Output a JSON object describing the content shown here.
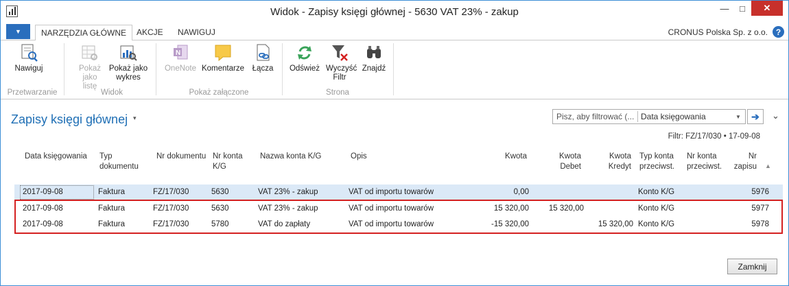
{
  "window": {
    "title": "Widok - Zapisy księgi głównej - 5630 VAT 23% - zakup",
    "controls": {
      "minimize": "—",
      "maximize": "□",
      "close": "✕"
    }
  },
  "ribbon_tabs": {
    "menu_arrow": "▼",
    "tabs": [
      {
        "label": "NARZĘDZIA GŁÓWNE",
        "active": true
      },
      {
        "label": "AKCJE",
        "active": false
      },
      {
        "label": "NAWIGUJ",
        "active": false
      }
    ],
    "company": "CRONUS Polska Sp. z o.o.",
    "help": "?"
  },
  "ribbon": {
    "buttons": [
      {
        "label": "Nawiguj",
        "icon": "navigate-icon",
        "enabled": true
      },
      {
        "label": "Pokaż jako listę",
        "icon": "list-view-icon",
        "enabled": false
      },
      {
        "label": "Pokaż jako wykres",
        "icon": "chart-view-icon",
        "enabled": true
      },
      {
        "label": "OneNote",
        "icon": "onenote-icon",
        "enabled": false
      },
      {
        "label": "Komentarze",
        "icon": "comments-icon",
        "enabled": true
      },
      {
        "label": "Łącza",
        "icon": "links-icon",
        "enabled": true
      },
      {
        "label": "Odśwież",
        "icon": "refresh-icon",
        "enabled": true
      },
      {
        "label": "Wyczyść Filtr",
        "icon": "clear-filter-icon",
        "enabled": true
      },
      {
        "label": "Znajdź",
        "icon": "find-icon",
        "enabled": true
      }
    ],
    "groups": [
      "Przetwarzanie",
      "Widok",
      "Pokaż załączone",
      "Strona"
    ]
  },
  "page": {
    "title": "Zapisy księgi głównej",
    "title_caret": "▾",
    "search_placeholder": "Pisz, aby filtrować (...",
    "filter_field": "Data księgowania",
    "filter_dropdown": "▼",
    "go_arrow": "➔",
    "collapse": "⌄",
    "filter_text": "Filtr: FZ/17/030 • 17-09-08"
  },
  "table": {
    "columns": [
      "Data księgowania",
      "Typ dokumentu",
      "Nr dokumentu",
      "Nr konta K/G",
      "Nazwa konta K/G",
      "Opis",
      "Kwota",
      "Kwota Debet",
      "Kwota Kredyt",
      "Typ konta przeciwst.",
      "Nr konta przeciwst.",
      "Nr zapisu"
    ],
    "sort_arrow": "▲",
    "rows": [
      {
        "date": "2017-09-08",
        "doc_type": "Faktura",
        "doc_no": "FZ/17/030",
        "account_no": "5630",
        "account_name": "VAT 23% - zakup",
        "description": "VAT od importu towarów",
        "amount": "0,00",
        "debit": "",
        "credit": "",
        "bal_type": "Konto K/G",
        "bal_no": "",
        "entry_no": "5976",
        "selected": true
      },
      {
        "date": "2017-09-08",
        "doc_type": "Faktura",
        "doc_no": "FZ/17/030",
        "account_no": "5630",
        "account_name": "VAT 23% - zakup",
        "description": "VAT od importu towarów",
        "amount": "15 320,00",
        "debit": "15 320,00",
        "credit": "",
        "bal_type": "Konto K/G",
        "bal_no": "",
        "entry_no": "5977",
        "selected": false
      },
      {
        "date": "2017-09-08",
        "doc_type": "Faktura",
        "doc_no": "FZ/17/030",
        "account_no": "5780",
        "account_name": "VAT do zapłaty",
        "description": "VAT od importu towarów",
        "amount": "-15 320,00",
        "debit": "",
        "credit": "15 320,00",
        "bal_type": "Konto K/G",
        "bal_no": "",
        "entry_no": "5978",
        "selected": false
      }
    ]
  },
  "footer": {
    "close_label": "Zamknij"
  }
}
